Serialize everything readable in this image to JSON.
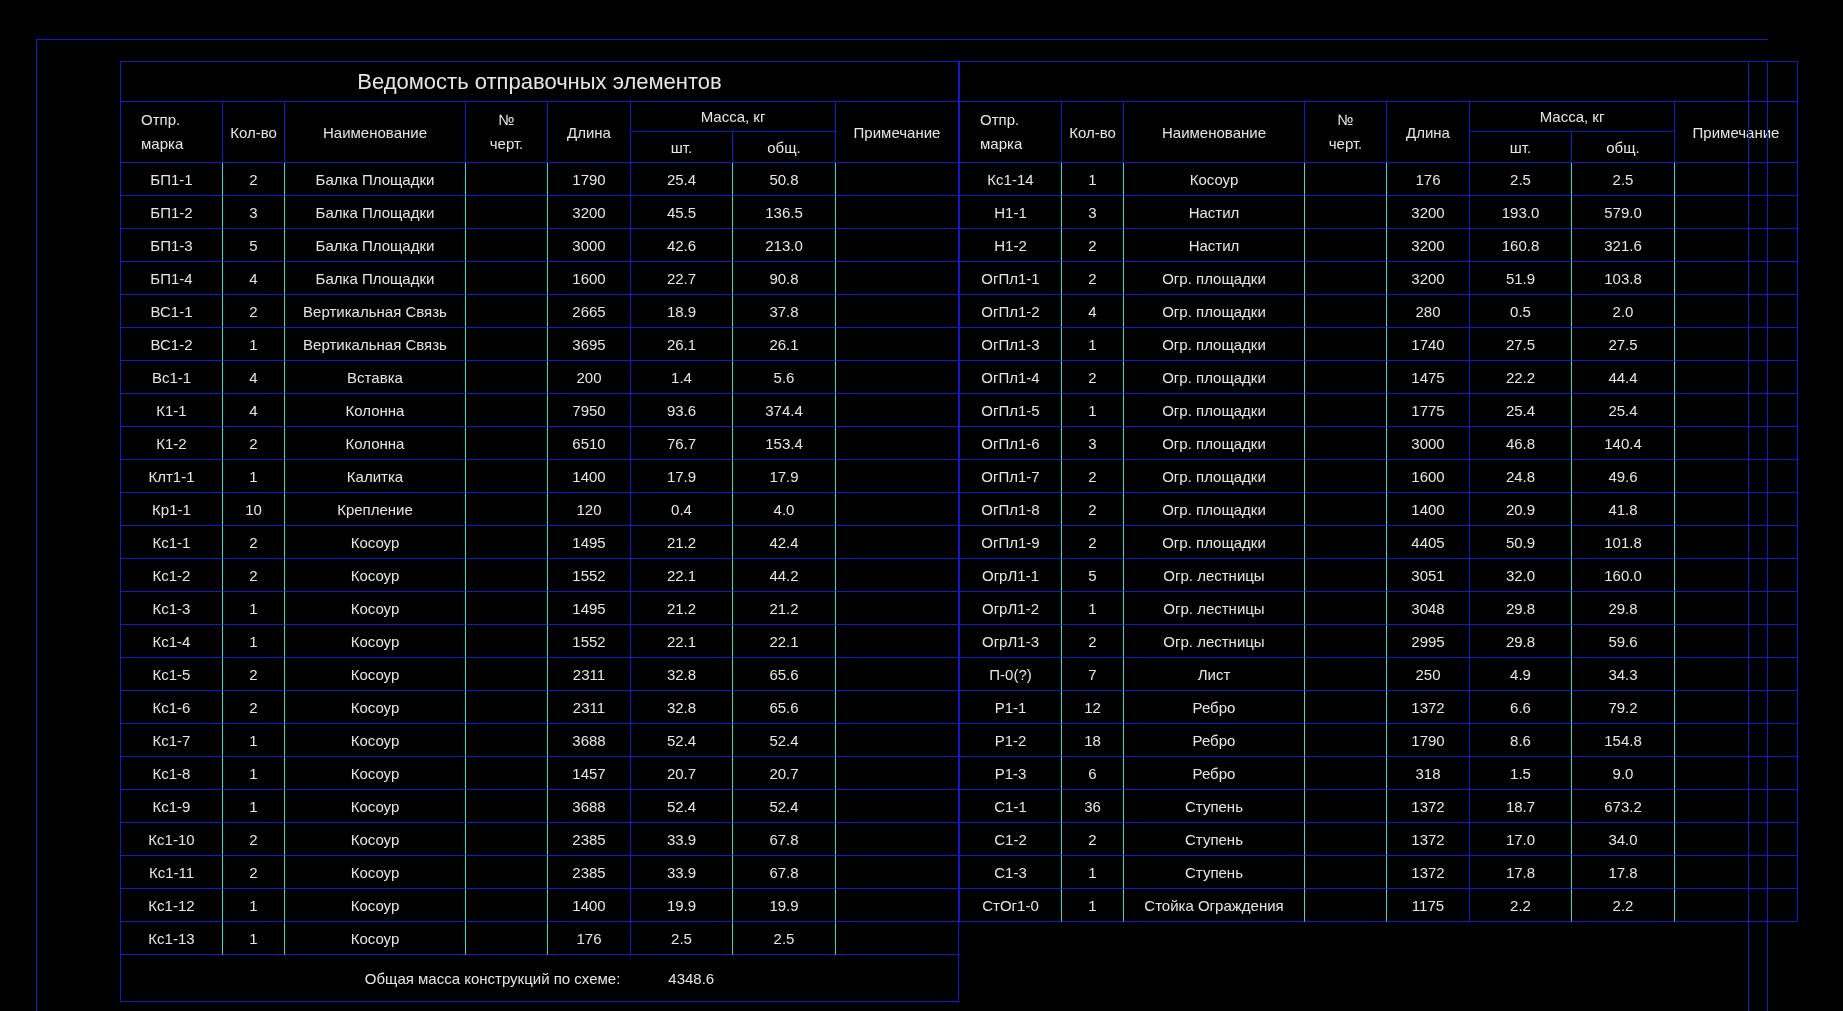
{
  "left_table": {
    "title": "Ведомость отправочных элементов",
    "columns": {
      "mark": "Отпр.\nмарка",
      "qty": "Кол-во",
      "name": "Наименование",
      "drawing": "№\nчерт.",
      "length": "Длина",
      "mass": "Масса, кг",
      "mass_unit": "шт.",
      "mass_total": "общ.",
      "notes": "Примечание"
    },
    "rows": [
      {
        "mark": "БП1-1",
        "qty": "2",
        "name": "Балка Площадки",
        "length": "1790",
        "mass_unit": "25.4",
        "mass_total": "50.8"
      },
      {
        "mark": "БП1-2",
        "qty": "3",
        "name": "Балка Площадки",
        "length": "3200",
        "mass_unit": "45.5",
        "mass_total": "136.5"
      },
      {
        "mark": "БП1-3",
        "qty": "5",
        "name": "Балка Площадки",
        "length": "3000",
        "mass_unit": "42.6",
        "mass_total": "213.0"
      },
      {
        "mark": "БП1-4",
        "qty": "4",
        "name": "Балка Площадки",
        "length": "1600",
        "mass_unit": "22.7",
        "mass_total": "90.8"
      },
      {
        "mark": "ВС1-1",
        "qty": "2",
        "name": "Вертикальная Связь",
        "length": "2665",
        "mass_unit": "18.9",
        "mass_total": "37.8"
      },
      {
        "mark": "ВС1-2",
        "qty": "1",
        "name": "Вертикальная Связь",
        "length": "3695",
        "mass_unit": "26.1",
        "mass_total": "26.1"
      },
      {
        "mark": "Вс1-1",
        "qty": "4",
        "name": "Вставка",
        "length": "200",
        "mass_unit": "1.4",
        "mass_total": "5.6"
      },
      {
        "mark": "К1-1",
        "qty": "4",
        "name": "Колонна",
        "length": "7950",
        "mass_unit": "93.6",
        "mass_total": "374.4"
      },
      {
        "mark": "К1-2",
        "qty": "2",
        "name": "Колонна",
        "length": "6510",
        "mass_unit": "76.7",
        "mass_total": "153.4"
      },
      {
        "mark": "Клт1-1",
        "qty": "1",
        "name": "Калитка",
        "length": "1400",
        "mass_unit": "17.9",
        "mass_total": "17.9"
      },
      {
        "mark": "Кр1-1",
        "qty": "10",
        "name": "Крепление",
        "length": "120",
        "mass_unit": "0.4",
        "mass_total": "4.0"
      },
      {
        "mark": "Кс1-1",
        "qty": "2",
        "name": "Косоур",
        "length": "1495",
        "mass_unit": "21.2",
        "mass_total": "42.4"
      },
      {
        "mark": "Кс1-2",
        "qty": "2",
        "name": "Косоур",
        "length": "1552",
        "mass_unit": "22.1",
        "mass_total": "44.2"
      },
      {
        "mark": "Кс1-3",
        "qty": "1",
        "name": "Косоур",
        "length": "1495",
        "mass_unit": "21.2",
        "mass_total": "21.2"
      },
      {
        "mark": "Кс1-4",
        "qty": "1",
        "name": "Косоур",
        "length": "1552",
        "mass_unit": "22.1",
        "mass_total": "22.1"
      },
      {
        "mark": "Кс1-5",
        "qty": "2",
        "name": "Косоур",
        "length": "2311",
        "mass_unit": "32.8",
        "mass_total": "65.6"
      },
      {
        "mark": "Кс1-6",
        "qty": "2",
        "name": "Косоур",
        "length": "2311",
        "mass_unit": "32.8",
        "mass_total": "65.6"
      },
      {
        "mark": "Кс1-7",
        "qty": "1",
        "name": "Косоур",
        "length": "3688",
        "mass_unit": "52.4",
        "mass_total": "52.4"
      },
      {
        "mark": "Кс1-8",
        "qty": "1",
        "name": "Косоур",
        "length": "1457",
        "mass_unit": "20.7",
        "mass_total": "20.7"
      },
      {
        "mark": "Кс1-9",
        "qty": "1",
        "name": "Косоур",
        "length": "3688",
        "mass_unit": "52.4",
        "mass_total": "52.4"
      },
      {
        "mark": "Кс1-10",
        "qty": "2",
        "name": "Косоур",
        "length": "2385",
        "mass_unit": "33.9",
        "mass_total": "67.8"
      },
      {
        "mark": "Кс1-11",
        "qty": "2",
        "name": "Косоур",
        "length": "2385",
        "mass_unit": "33.9",
        "mass_total": "67.8"
      },
      {
        "mark": "Кс1-12",
        "qty": "1",
        "name": "Косоур",
        "length": "1400",
        "mass_unit": "19.9",
        "mass_total": "19.9"
      },
      {
        "mark": "Кс1-13",
        "qty": "1",
        "name": "Косоур",
        "length": "176",
        "mass_unit": "2.5",
        "mass_total": "2.5"
      }
    ],
    "total": {
      "label": "Общая масса конструкций по схеме:",
      "value": "4348.6"
    }
  },
  "right_table": {
    "columns": {
      "mark": "Отпр.\nмарка",
      "qty": "Кол-во",
      "name": "Наименование",
      "drawing": "№\nчерт.",
      "length": "Длина",
      "mass": "Масса, кг",
      "mass_unit": "шт.",
      "mass_total": "общ.",
      "notes": "Примечание"
    },
    "rows": [
      {
        "mark": "Кс1-14",
        "qty": "1",
        "name": "Косоур",
        "length": "176",
        "mass_unit": "2.5",
        "mass_total": "2.5"
      },
      {
        "mark": "Н1-1",
        "qty": "3",
        "name": "Настил",
        "length": "3200",
        "mass_unit": "193.0",
        "mass_total": "579.0"
      },
      {
        "mark": "Н1-2",
        "qty": "2",
        "name": "Настил",
        "length": "3200",
        "mass_unit": "160.8",
        "mass_total": "321.6"
      },
      {
        "mark": "ОгПл1-1",
        "qty": "2",
        "name": "Огр. площадки",
        "length": "3200",
        "mass_unit": "51.9",
        "mass_total": "103.8"
      },
      {
        "mark": "ОгПл1-2",
        "qty": "4",
        "name": "Огр. площадки",
        "length": "280",
        "mass_unit": "0.5",
        "mass_total": "2.0"
      },
      {
        "mark": "ОгПл1-3",
        "qty": "1",
        "name": "Огр. площадки",
        "length": "1740",
        "mass_unit": "27.5",
        "mass_total": "27.5"
      },
      {
        "mark": "ОгПл1-4",
        "qty": "2",
        "name": "Огр. площадки",
        "length": "1475",
        "mass_unit": "22.2",
        "mass_total": "44.4"
      },
      {
        "mark": "ОгПл1-5",
        "qty": "1",
        "name": "Огр. площадки",
        "length": "1775",
        "mass_unit": "25.4",
        "mass_total": "25.4"
      },
      {
        "mark": "ОгПл1-6",
        "qty": "3",
        "name": "Огр. площадки",
        "length": "3000",
        "mass_unit": "46.8",
        "mass_total": "140.4"
      },
      {
        "mark": "ОгПл1-7",
        "qty": "2",
        "name": "Огр. площадки",
        "length": "1600",
        "mass_unit": "24.8",
        "mass_total": "49.6"
      },
      {
        "mark": "ОгПл1-8",
        "qty": "2",
        "name": "Огр. площадки",
        "length": "1400",
        "mass_unit": "20.9",
        "mass_total": "41.8"
      },
      {
        "mark": "ОгПл1-9",
        "qty": "2",
        "name": "Огр. площадки",
        "length": "4405",
        "mass_unit": "50.9",
        "mass_total": "101.8"
      },
      {
        "mark": "ОгрЛ1-1",
        "qty": "5",
        "name": "Огр. лестницы",
        "length": "3051",
        "mass_unit": "32.0",
        "mass_total": "160.0"
      },
      {
        "mark": "ОгрЛ1-2",
        "qty": "1",
        "name": "Огр. лестницы",
        "length": "3048",
        "mass_unit": "29.8",
        "mass_total": "29.8"
      },
      {
        "mark": "ОгрЛ1-3",
        "qty": "2",
        "name": "Огр. лестницы",
        "length": "2995",
        "mass_unit": "29.8",
        "mass_total": "59.6"
      },
      {
        "mark": "П-0(?)",
        "qty": "7",
        "name": "Лист",
        "length": "250",
        "mass_unit": "4.9",
        "mass_total": "34.3"
      },
      {
        "mark": "Р1-1",
        "qty": "12",
        "name": "Ребро",
        "length": "1372",
        "mass_unit": "6.6",
        "mass_total": "79.2"
      },
      {
        "mark": "Р1-2",
        "qty": "18",
        "name": "Ребро",
        "length": "1790",
        "mass_unit": "8.6",
        "mass_total": "154.8"
      },
      {
        "mark": "Р1-3",
        "qty": "6",
        "name": "Ребро",
        "length": "318",
        "mass_unit": "1.5",
        "mass_total": "9.0"
      },
      {
        "mark": "С1-1",
        "qty": "36",
        "name": "Ступень",
        "length": "1372",
        "mass_unit": "18.7",
        "mass_total": "673.2"
      },
      {
        "mark": "С1-2",
        "qty": "2",
        "name": "Ступень",
        "length": "1372",
        "mass_unit": "17.0",
        "mass_total": "34.0"
      },
      {
        "mark": "С1-3",
        "qty": "1",
        "name": "Ступень",
        "length": "1372",
        "mass_unit": "17.8",
        "mass_total": "17.8"
      },
      {
        "mark": "СтОг1-0",
        "qty": "1",
        "name": "Стойка Ограждения",
        "length": "1175",
        "mass_unit": "2.2",
        "mass_total": "2.2"
      }
    ]
  }
}
